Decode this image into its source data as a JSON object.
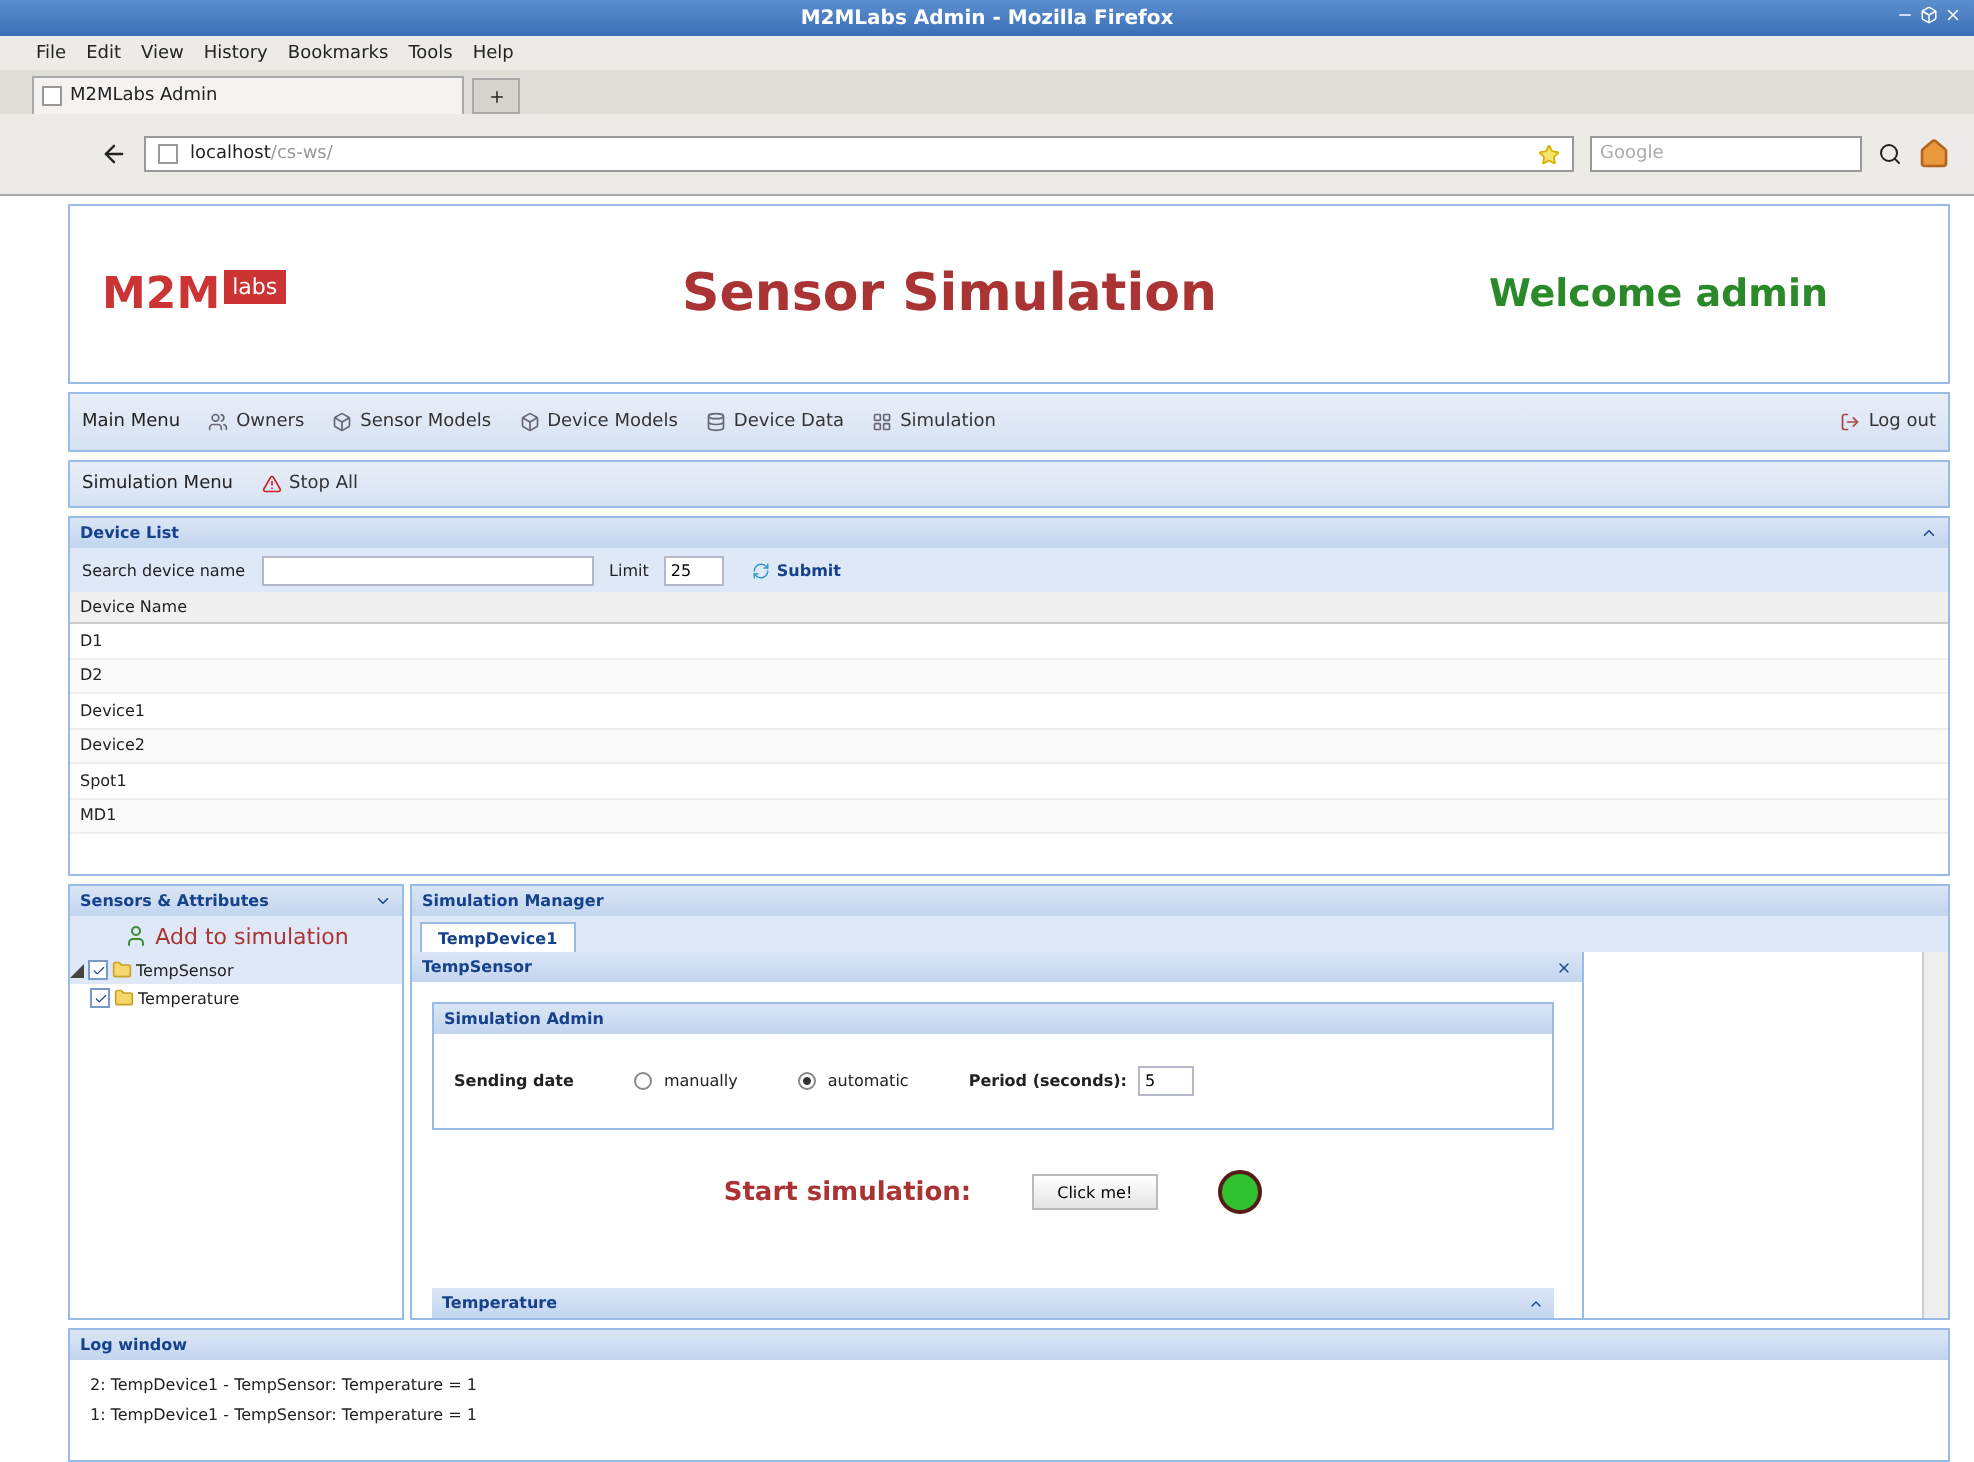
{
  "window": {
    "title": "M2MLabs Admin - Mozilla Firefox"
  },
  "menu": [
    "File",
    "Edit",
    "View",
    "History",
    "Bookmarks",
    "Tools",
    "Help"
  ],
  "browser_tab": {
    "label": "M2MLabs Admin"
  },
  "address": {
    "host": "localhost",
    "path": "/cs-ws/"
  },
  "search": {
    "placeholder": "Google"
  },
  "header": {
    "logo_main": "M2M",
    "logo_badge": "labs",
    "title": "Sensor Simulation",
    "welcome": "Welcome admin"
  },
  "main_menu": {
    "label": "Main Menu",
    "items": [
      "Owners",
      "Sensor Models",
      "Device Models",
      "Device Data",
      "Simulation"
    ],
    "logout": "Log out"
  },
  "simulation_menu": {
    "label": "Simulation Menu",
    "stop": "Stop All"
  },
  "device_list": {
    "title": "Device List",
    "search_label": "Search device name",
    "limit_label": "Limit",
    "limit": "25",
    "submit": "Submit",
    "column": "Device Name",
    "rows": [
      "D1",
      "D2",
      "Device1",
      "Device2",
      "Spot1",
      "MD1"
    ]
  },
  "sensors": {
    "title": "Sensors & Attributes",
    "add": "Add to simulation",
    "tree": [
      {
        "label": "TempSensor",
        "checked": true,
        "expanded": true,
        "children": [
          {
            "label": "Temperature",
            "checked": true
          }
        ]
      }
    ]
  },
  "manager": {
    "title": "Simulation Manager",
    "tabs": [
      {
        "label": "TempDevice1",
        "selected": true
      }
    ],
    "panel": "TempSensor",
    "admin": {
      "title": "Simulation Admin",
      "sending_label": "Sending date",
      "modes": [
        {
          "label": "manually",
          "selected": false
        },
        {
          "label": "automatic",
          "selected": true
        }
      ],
      "period_label": "Period (seconds):",
      "period": "5"
    },
    "start_label": "Start simulation:",
    "start_button": "Click me!",
    "collapsed_panel": "Temperature"
  },
  "log": {
    "title": "Log window",
    "lines": [
      "2: TempDevice1 - TempSensor: Temperature = 1",
      "1: TempDevice1 - TempSensor: Temperature = 1"
    ]
  }
}
